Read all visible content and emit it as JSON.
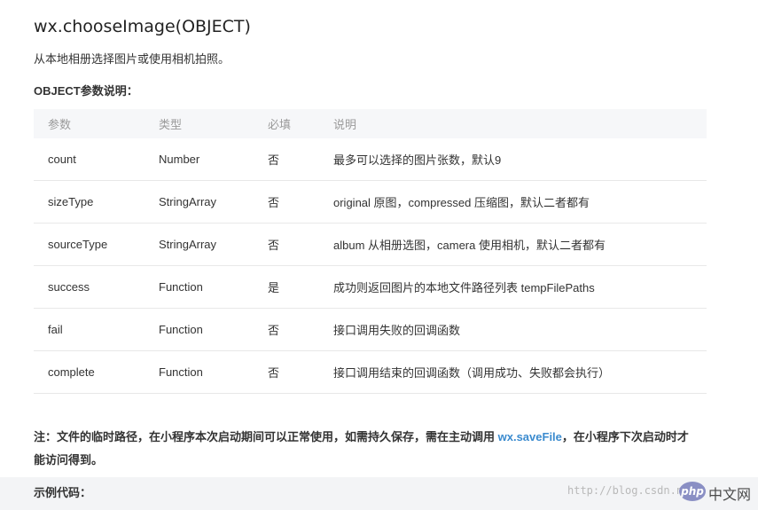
{
  "doc": {
    "title": "wx.chooseImage(OBJECT)",
    "description": "从本地相册选择图片或使用相机拍照。",
    "section_title": "OBJECT参数说明："
  },
  "table": {
    "headers": [
      "参数",
      "类型",
      "必填",
      "说明"
    ],
    "rows": [
      {
        "name": "count",
        "type": "Number",
        "required": "否",
        "desc": "最多可以选择的图片张数，默认9"
      },
      {
        "name": "sizeType",
        "type": "StringArray",
        "required": "否",
        "desc": "original 原图，compressed 压缩图，默认二者都有"
      },
      {
        "name": "sourceType",
        "type": "StringArray",
        "required": "否",
        "desc": "album 从相册选图，camera 使用相机，默认二者都有"
      },
      {
        "name": "success",
        "type": "Function",
        "required": "是",
        "desc": "成功则返回图片的本地文件路径列表 tempFilePaths"
      },
      {
        "name": "fail",
        "type": "Function",
        "required": "否",
        "desc": "接口调用失败的回调函数"
      },
      {
        "name": "complete",
        "type": "Function",
        "required": "否",
        "desc": "接口调用结束的回调函数（调用成功、失败都会执行）"
      }
    ]
  },
  "note": {
    "before": "注：文件的临时路径，在小程序本次启动期间可以正常使用，如需持久保存，需在主动调用 ",
    "link": "wx.saveFile",
    "after": "，在小程序下次启动时才能访问得到。"
  },
  "example": {
    "title": "示例代码："
  },
  "watermark": {
    "url": "http://blog.csdn.n",
    "badge": "php",
    "site": "中文网"
  }
}
